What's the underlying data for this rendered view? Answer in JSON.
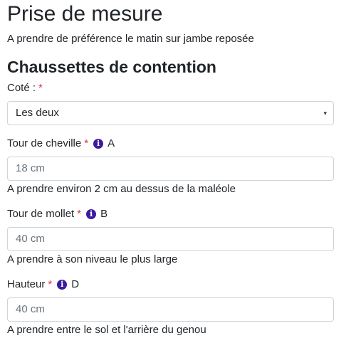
{
  "page": {
    "title": "Prise de mesure",
    "subtitle": "A prendre de préférence le matin sur jambe reposée",
    "section_title": "Chaussettes de contention"
  },
  "fields": {
    "side": {
      "label": "Coté :",
      "required": "*",
      "value": "Les deux",
      "caret": "▾"
    },
    "ankle": {
      "label": "Tour de cheville",
      "required": "*",
      "info_icon": "i",
      "letter": "A",
      "placeholder": "18 cm",
      "help": "A prendre environ 2 cm au dessus de la maléole"
    },
    "calf": {
      "label": "Tour de mollet",
      "required": "*",
      "info_icon": "i",
      "letter": "B",
      "placeholder": "40 cm",
      "help": "A prendre à son niveau le plus large"
    },
    "height": {
      "label": "Hauteur",
      "required": "*",
      "info_icon": "i",
      "letter": "D",
      "placeholder": "40 cm",
      "help": "A prendre entre le sol et l'arrière du genou"
    }
  }
}
